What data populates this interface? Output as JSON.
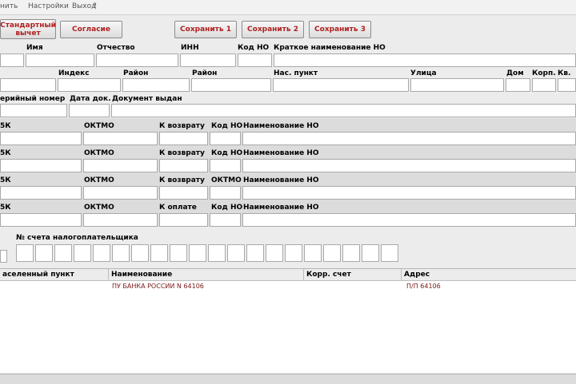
{
  "menu": {
    "items": [
      "нить",
      "Настройки",
      "Выход",
      "?"
    ]
  },
  "buttons": {
    "standard": "Стандартный вычет",
    "consent": "Согласие",
    "save1": "Сохранить 1",
    "save2": "Сохранить 2",
    "save3": "Сохранить 3"
  },
  "row1": {
    "first_name": "Имя",
    "patronymic": "Отчество",
    "inn": "ИНН",
    "tax_code": "Код НО",
    "tax_short": "Краткое наименование НО"
  },
  "row2": {
    "index": "Индекс",
    "district1": "Район",
    "district2": "Район",
    "settlement": "Нас. пункт",
    "street": "Улица",
    "house": "Дом",
    "building": "Корп.",
    "flat": "Кв."
  },
  "row3": {
    "serial": "ерийный номер",
    "doc_date": "Дата док.",
    "doc_issued": "Документ выдан"
  },
  "bk_blocks": [
    {
      "kbk": "5К",
      "oktmo": "ОКТМО",
      "amount": "К возврату",
      "code": "Код НО",
      "name": "Наименование НО"
    },
    {
      "kbk": "5К",
      "oktmo": "ОКТМО",
      "amount": "К возврату",
      "code": "Код НО",
      "name": "Наименование НО"
    },
    {
      "kbk": "5К",
      "oktmo": "ОКТМО",
      "amount": "К возврату",
      "code": "ОКТМО",
      "name": "Наименование НО"
    },
    {
      "kbk": "5К",
      "oktmo": "ОКТМО",
      "amount": "К оплате",
      "code": "Код НО",
      "name": "Наименование НО"
    }
  ],
  "account": {
    "label": "№ счета налогоплательщика",
    "digits": 20
  },
  "table": {
    "headers": [
      "аселенный пункт",
      "Наименование",
      "Корр. счет",
      "Адрес"
    ],
    "rows": [
      [
        "",
        "ПУ БАНКА РОССИИ N 64106",
        "",
        "П/П 64106"
      ]
    ]
  }
}
